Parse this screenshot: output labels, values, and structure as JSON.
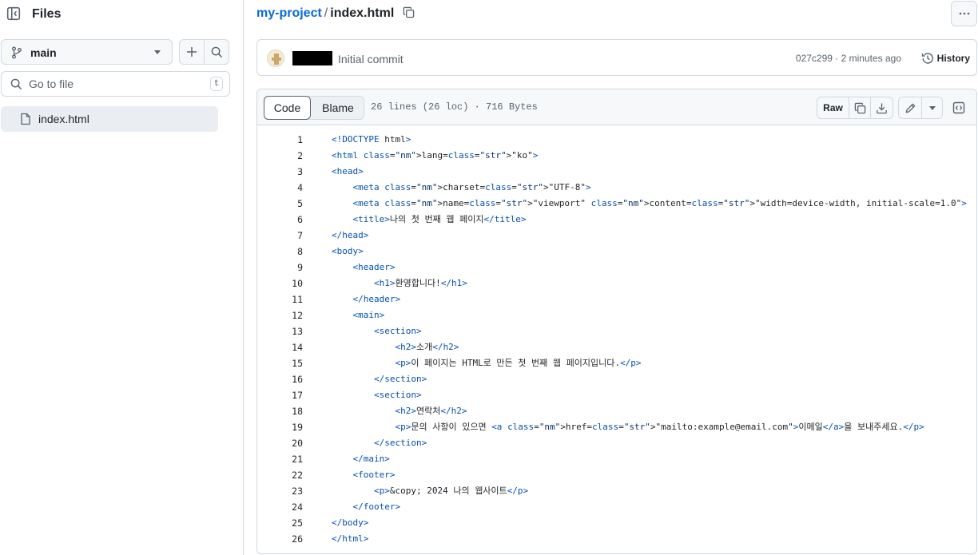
{
  "sidebar": {
    "title": "Files",
    "branch": "main",
    "goto_placeholder": "Go to file",
    "goto_shortcut": "t",
    "tree": [
      {
        "name": "index.html"
      }
    ]
  },
  "breadcrumb": {
    "repo": "my-project",
    "separator": "/",
    "file": "index.html"
  },
  "commit": {
    "message": "Initial commit",
    "meta": "027c299 · 2 minutes ago",
    "history_label": "History"
  },
  "file": {
    "tabs": {
      "code": "Code",
      "blame": "Blame"
    },
    "info": "26 lines (26 loc) · 716 Bytes",
    "raw_label": "Raw",
    "lines": [
      "<!DOCTYPE html>",
      "<html lang=\"ko\">",
      "<head>",
      "    <meta charset=\"UTF-8\">",
      "    <meta name=\"viewport\" content=\"width=device-width, initial-scale=1.0\">",
      "    <title>나의 첫 번째 웹 페이지</title>",
      "</head>",
      "<body>",
      "    <header>",
      "        <h1>환영합니다!</h1>",
      "    </header>",
      "    <main>",
      "        <section>",
      "            <h2>소개</h2>",
      "            <p>이 페이지는 HTML로 만든 첫 번째 웹 페이지입니다.</p>",
      "        </section>",
      "        <section>",
      "            <h2>연락처</h2>",
      "            <p>문의 사항이 있으면 <a href=\"mailto:example@email.com\">이메일</a>을 보내주세요.</p>",
      "        </section>",
      "    </main>",
      "    <footer>",
      "        <p>&copy; 2024 나의 웹사이트</p>",
      "    </footer>",
      "</body>",
      "</html>"
    ]
  },
  "colors": {
    "link": "#0969da",
    "tag": "#116329",
    "attr": "#0550ae",
    "string": "#0a3069",
    "border": "#d1d9e0",
    "muted": "#59636e"
  },
  "icons": [
    "sidebar-collapse-icon",
    "git-branch-icon",
    "plus-icon",
    "search-icon",
    "file-icon",
    "copy-icon",
    "kebab-horizontal-icon",
    "history-icon",
    "download-icon",
    "pencil-icon",
    "chevron-down-icon",
    "code-square-icon"
  ]
}
